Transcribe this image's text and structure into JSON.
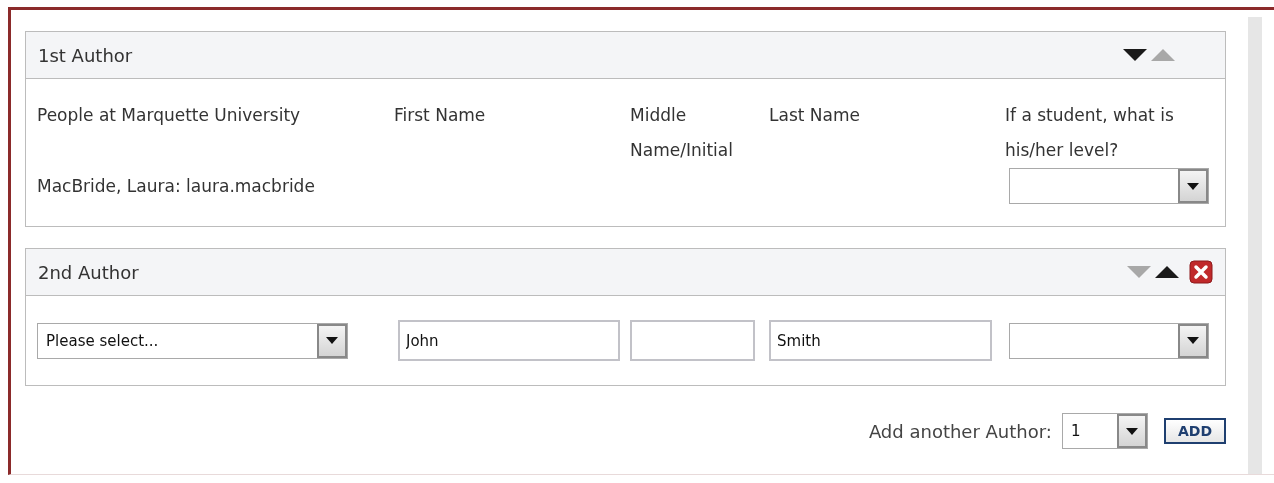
{
  "authors": [
    {
      "title": "1st Author",
      "kind": "fixed",
      "move_down_enabled": true,
      "move_up_enabled": false,
      "removable": false,
      "column_headers": [
        "People at Marquette University",
        "First Name",
        "Middle Name/Initial",
        "Last Name",
        "If a student, what is his/her level?"
      ],
      "person": "MacBride, Laura: laura.macbride"
    },
    {
      "title": "2nd Author",
      "kind": "editable",
      "move_down_enabled": false,
      "move_up_enabled": true,
      "removable": true,
      "person_select": "Please select...",
      "first_name": "John",
      "last_name": "Smith"
    }
  ],
  "add_row": {
    "label": "Add another Author:",
    "count": "1",
    "button": "ADD"
  }
}
